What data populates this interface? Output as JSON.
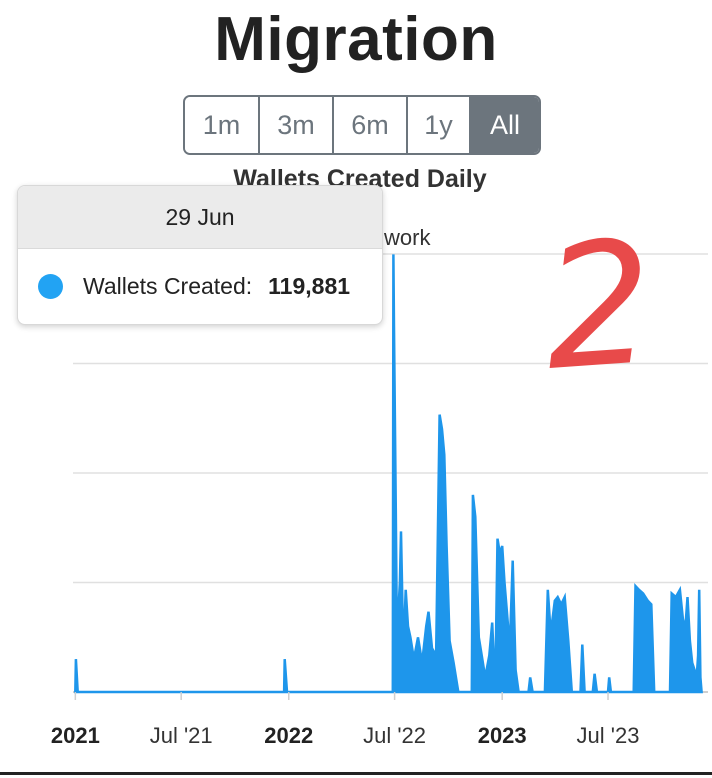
{
  "page": {
    "title": "Migration"
  },
  "range_buttons": [
    {
      "label": "1m",
      "active": false
    },
    {
      "label": "3m",
      "active": false
    },
    {
      "label": "6m",
      "active": false
    },
    {
      "label": "1y",
      "active": false
    },
    {
      "label": "All",
      "active": true
    }
  ],
  "chart_data": {
    "type": "bar",
    "title": "Wallets Created Daily",
    "subtitle_fragment": "work",
    "series": [
      {
        "name": "Wallets Created",
        "color": "#1e96eb",
        "points": [
          [
            "2021-01-01",
            0
          ],
          [
            "2021-01-02",
            9000
          ],
          [
            "2021-01-05",
            0
          ],
          [
            "2021-12-24",
            0
          ],
          [
            "2021-12-25",
            9000
          ],
          [
            "2021-12-29",
            0
          ],
          [
            "2022-06-28",
            0
          ],
          [
            "2022-06-29",
            119881
          ],
          [
            "2022-06-30",
            100000
          ],
          [
            "2022-07-03",
            50000
          ],
          [
            "2022-07-05",
            15000
          ],
          [
            "2022-07-10",
            30000
          ],
          [
            "2022-07-12",
            44000
          ],
          [
            "2022-07-16",
            10000
          ],
          [
            "2022-07-20",
            28000
          ],
          [
            "2022-07-24",
            18000
          ],
          [
            "2022-07-28",
            15000
          ],
          [
            "2022-08-03",
            9000
          ],
          [
            "2022-08-10",
            15000
          ],
          [
            "2022-08-17",
            8000
          ],
          [
            "2022-08-24",
            18000
          ],
          [
            "2022-08-28",
            22000
          ],
          [
            "2022-09-03",
            12000
          ],
          [
            "2022-09-10",
            10000
          ],
          [
            "2022-09-16",
            76000
          ],
          [
            "2022-09-20",
            72000
          ],
          [
            "2022-09-24",
            65000
          ],
          [
            "2022-09-28",
            40000
          ],
          [
            "2022-10-03",
            14000
          ],
          [
            "2022-10-10",
            8000
          ],
          [
            "2022-10-18",
            0
          ],
          [
            "2022-11-10",
            0
          ],
          [
            "2022-11-12",
            54000
          ],
          [
            "2022-11-16",
            48000
          ],
          [
            "2022-11-22",
            15000
          ],
          [
            "2022-11-28",
            9000
          ],
          [
            "2022-12-03",
            4000
          ],
          [
            "2022-12-10",
            10000
          ],
          [
            "2022-12-15",
            19000
          ],
          [
            "2022-12-20",
            0
          ],
          [
            "2022-12-24",
            42000
          ],
          [
            "2022-12-28",
            38000
          ],
          [
            "2023-01-01",
            40000
          ],
          [
            "2023-01-05",
            30000
          ],
          [
            "2023-01-09",
            22000
          ],
          [
            "2023-01-14",
            12000
          ],
          [
            "2023-01-19",
            36000
          ],
          [
            "2023-01-24",
            6000
          ],
          [
            "2023-01-29",
            0
          ],
          [
            "2023-02-15",
            0
          ],
          [
            "2023-02-18",
            4000
          ],
          [
            "2023-02-22",
            0
          ],
          [
            "2023-03-15",
            0
          ],
          [
            "2023-03-20",
            28000
          ],
          [
            "2023-03-25",
            16000
          ],
          [
            "2023-04-01",
            25000
          ],
          [
            "2023-04-06",
            26000
          ],
          [
            "2023-04-12",
            24000
          ],
          [
            "2023-04-18",
            26000
          ],
          [
            "2023-04-24",
            14000
          ],
          [
            "2023-04-30",
            0
          ],
          [
            "2023-05-15",
            0
          ],
          [
            "2023-05-18",
            13000
          ],
          [
            "2023-05-22",
            0
          ],
          [
            "2023-06-05",
            0
          ],
          [
            "2023-06-08",
            5000
          ],
          [
            "2023-06-12",
            0
          ],
          [
            "2023-07-01",
            0
          ],
          [
            "2023-07-03",
            4000
          ],
          [
            "2023-07-06",
            0
          ],
          [
            "2023-08-14",
            0
          ],
          [
            "2023-08-17",
            29000
          ],
          [
            "2023-08-23",
            28000
          ],
          [
            "2023-08-30",
            27000
          ],
          [
            "2023-09-07",
            25000
          ],
          [
            "2023-09-13",
            24000
          ],
          [
            "2023-09-18",
            0
          ],
          [
            "2023-10-15",
            0
          ],
          [
            "2023-10-18",
            27000
          ],
          [
            "2023-10-25",
            26000
          ],
          [
            "2023-11-01",
            28000
          ],
          [
            "2023-11-06",
            20000
          ],
          [
            "2023-11-10",
            17000
          ],
          [
            "2023-11-14",
            26000
          ],
          [
            "2023-11-18",
            14000
          ],
          [
            "2023-11-22",
            8000
          ],
          [
            "2023-11-26",
            6000
          ],
          [
            "2023-11-30",
            5000
          ],
          [
            "2023-12-02",
            10000
          ],
          [
            "2023-12-04",
            28000
          ],
          [
            "2023-12-06",
            4000
          ],
          [
            "2023-12-08",
            0
          ]
        ]
      }
    ],
    "x_axis": {
      "ticks": [
        {
          "label": "2021",
          "date": "2021-01-01",
          "bold": true
        },
        {
          "label": "Jul '21",
          "date": "2021-07-01",
          "bold": false
        },
        {
          "label": "2022",
          "date": "2022-01-01",
          "bold": true
        },
        {
          "label": "Jul '22",
          "date": "2022-07-01",
          "bold": false
        },
        {
          "label": "2023",
          "date": "2023-01-01",
          "bold": true
        },
        {
          "label": "Jul '23",
          "date": "2023-07-01",
          "bold": false
        }
      ],
      "range": [
        "2020-12-28",
        "2023-12-19"
      ]
    },
    "y_axis": {
      "ylim": [
        0,
        120000
      ],
      "gridlines": [
        0,
        30000,
        60000,
        90000,
        120000
      ],
      "labels_visible": false
    },
    "grid": true,
    "legend": "none",
    "tooltip": {
      "date": "29 Jun",
      "series_label": "Wallets Created:",
      "value": "119,881"
    }
  },
  "annotation": {
    "text": "2",
    "color": "#e84a4a"
  }
}
